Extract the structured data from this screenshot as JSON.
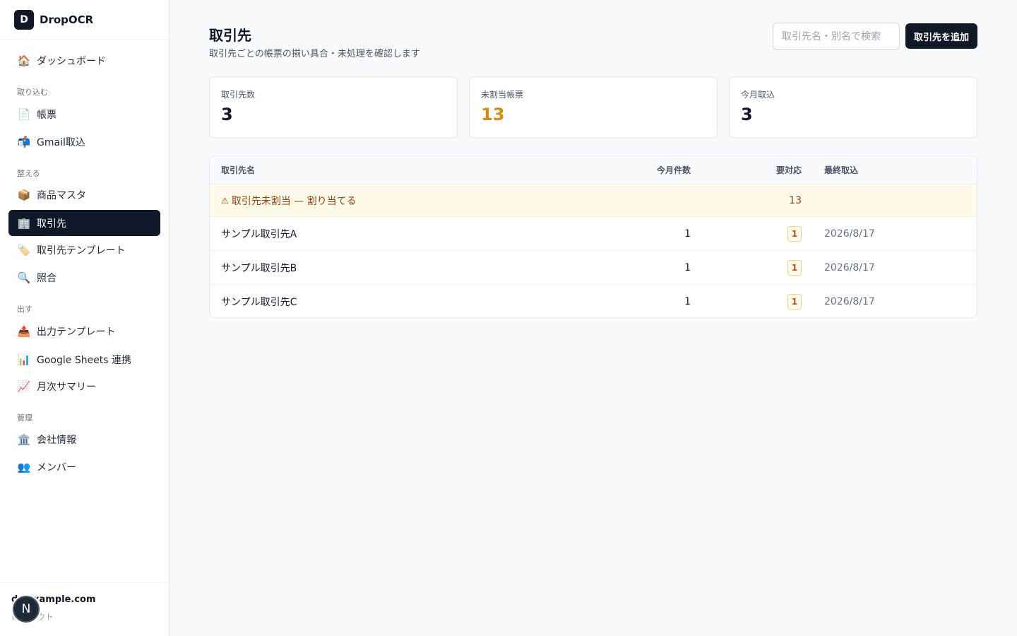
{
  "brand": {
    "logo_letter": "D",
    "name": "DropOCR"
  },
  "sidebar": {
    "items": [
      {
        "label": "ダッシュボード",
        "icon": "🏠",
        "icon_name": "house-icon"
      },
      {
        "label": "帳票",
        "icon": "📄",
        "icon_name": "document-icon"
      },
      {
        "label": "Gmail取込",
        "icon": "📬",
        "icon_name": "mailbox-icon"
      },
      {
        "label": "商品マスタ",
        "icon": "📦",
        "icon_name": "package-icon"
      },
      {
        "label": "取引先",
        "icon": "🏢",
        "icon_name": "building-icon",
        "active": true
      },
      {
        "label": "取引先テンプレート",
        "icon": "🏷️",
        "icon_name": "tag-icon"
      },
      {
        "label": "照合",
        "icon": "🔍",
        "icon_name": "magnifier-icon"
      },
      {
        "label": "出力テンプレート",
        "icon": "📤",
        "icon_name": "outbox-icon"
      },
      {
        "label": "Google Sheets 連携",
        "icon": "📊",
        "icon_name": "bar-chart-icon"
      },
      {
        "label": "月次サマリー",
        "icon": "📈",
        "icon_name": "line-chart-icon"
      },
      {
        "label": "会社情報",
        "icon": "🏛️",
        "icon_name": "bank-icon"
      },
      {
        "label": "メンバー",
        "icon": "👥",
        "icon_name": "people-icon"
      }
    ],
    "sections": [
      "取り込む",
      "整える",
      "出す",
      "管理"
    ],
    "footer": {
      "email": "d@example.com",
      "logout": "ログアウト",
      "badge": "N"
    }
  },
  "header": {
    "title": "取引先",
    "subtitle": "取引先ごとの帳票の揃い具合・未処理を確認します",
    "search_placeholder": "取引先名・別名で検索",
    "add_button": "取引先を追加"
  },
  "stats": [
    {
      "label": "取引先数",
      "value": "3"
    },
    {
      "label": "未割当帳票",
      "value": "13"
    },
    {
      "label": "今月取込",
      "value": "3"
    }
  ],
  "table": {
    "headers": {
      "name": "取引先名",
      "month": "今月件数",
      "todo": "要対応",
      "last": "最終取込"
    },
    "unassigned": {
      "icon": "⚠",
      "label": "取引先未割当 — 割り当てる",
      "count": "13"
    },
    "rows": [
      {
        "name": "サンプル取引先A",
        "month": "1",
        "todo": "1",
        "last": "2026/8/17"
      },
      {
        "name": "サンプル取引先B",
        "month": "1",
        "todo": "1",
        "last": "2026/8/17"
      },
      {
        "name": "サンプル取引先C",
        "month": "1",
        "todo": "1",
        "last": "2026/8/17"
      }
    ]
  },
  "colors": {
    "accent": "#111827",
    "warning": "#d08c1c",
    "warning_bg": "#fefbea"
  }
}
